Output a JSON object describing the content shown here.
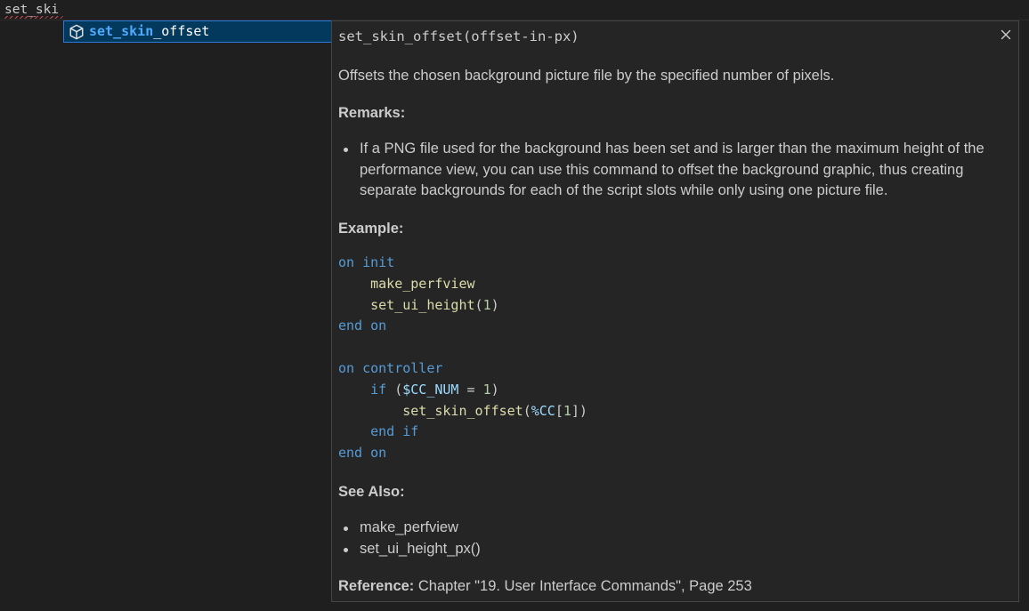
{
  "editor": {
    "typed_text": "set_ski"
  },
  "suggest": {
    "item_label_match": "set_skin",
    "item_label_rest": "_offset",
    "item_icon": "cube-icon"
  },
  "details": {
    "signature": "set_skin_offset(offset-in-px)",
    "close_icon": "close-icon",
    "description": "Offsets the chosen background picture file by the specified number of pixels.",
    "remarks_heading": "Remarks:",
    "remarks": [
      "If a PNG file used for the background has been set and is larger than the maximum height of the performance view, you can use this command to offset the background graphic, thus creating separate backgrounds for each of the script slots while only using one picture file."
    ],
    "example_heading": "Example:",
    "code": {
      "l1_kw": "on",
      "l1_name": "init",
      "l2_fn": "make_perfview",
      "l3_fn": "set_ui_height",
      "l3_open": "(",
      "l3_num": "1",
      "l3_close": ")",
      "l4_kw1": "end",
      "l4_kw2": "on",
      "l6_kw": "on",
      "l6_name": "controller",
      "l7_kw": "if",
      "l7_open": " (",
      "l7_var": "$CC_NUM",
      "l7_eq": " = ",
      "l7_num": "1",
      "l7_close": ")",
      "l8_fn": "set_skin_offset",
      "l8_open": "(",
      "l8_var": "%CC",
      "l8_b1": "[",
      "l8_num": "1",
      "l8_b2": "])",
      "l9_kw1": "end",
      "l9_kw2": "if",
      "l10_kw1": "end",
      "l10_kw2": "on"
    },
    "see_also_heading": "See Also:",
    "see_also": [
      "make_perfview",
      "set_ui_height_px()"
    ],
    "reference_label": "Reference:",
    "reference_text": " Chapter \"19. User Interface Commands\", Page 253"
  },
  "colors": {
    "keyword": "#569cd6",
    "function": "#dcdcaa",
    "number": "#b5cea8",
    "variable": "#9cdcfe",
    "selection": "#04395e",
    "match_highlight": "#4daafc"
  }
}
